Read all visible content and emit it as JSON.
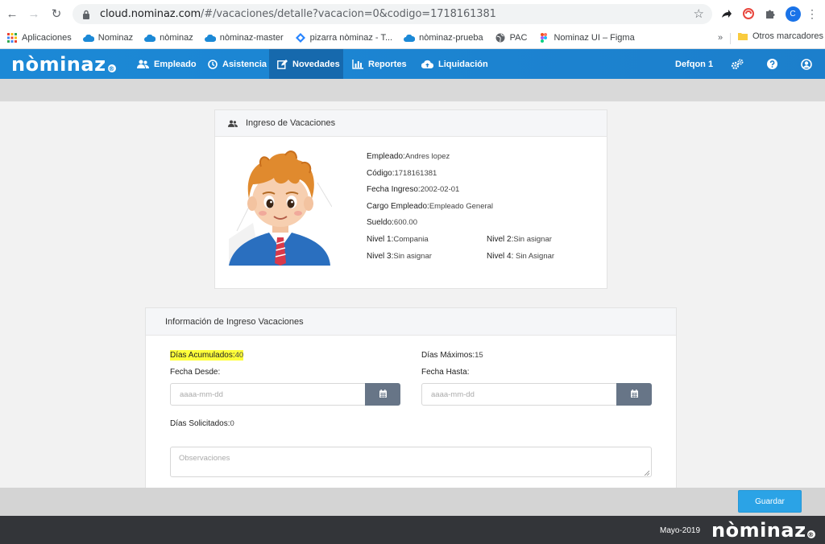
{
  "browser": {
    "url_host": "cloud.nominaz.com",
    "url_path": "/#/vacaciones/detalle?vacacion=0&codigo=1718161381",
    "profile_initial": "C",
    "bookmarks": [
      {
        "label": "Aplicaciones",
        "icon": "apps-grid-icon"
      },
      {
        "label": "Nominaz",
        "icon": "cloud-icon"
      },
      {
        "label": "nòminaz",
        "icon": "cloud-icon"
      },
      {
        "label": "nòminaz-master",
        "icon": "cloud-icon"
      },
      {
        "label": "pizarra nòminaz - T...",
        "icon": "diamond-icon"
      },
      {
        "label": "nòminaz-prueba",
        "icon": "cloud-icon"
      },
      {
        "label": "PAC",
        "icon": "globe-icon"
      },
      {
        "label": "Nominaz UI – Figma",
        "icon": "figma-icon"
      }
    ],
    "bookmarks_more": "»",
    "other_bookmarks": "Otros marcadores"
  },
  "app": {
    "logo_text": "nòminaz",
    "nav": [
      {
        "label": "Empleado",
        "icon": "users-icon",
        "active": false
      },
      {
        "label": "Asistencia",
        "icon": "clock-icon",
        "active": false
      },
      {
        "label": "Novedades",
        "icon": "edit-icon",
        "active": true
      },
      {
        "label": "Reportes",
        "icon": "bar-chart-icon",
        "active": false
      },
      {
        "label": "Liquidación",
        "icon": "cloud-upload-icon",
        "active": false
      }
    ],
    "company": "Defqon 1"
  },
  "employee_card": {
    "title": "Ingreso de Vacaciones",
    "fields": {
      "empleado_label": "Empleado:",
      "empleado": "Andres lopez",
      "codigo_label": "Código:",
      "codigo": "1718161381",
      "fecha_ingreso_label": "Fecha Ingreso:",
      "fecha_ingreso": "2002-02-01",
      "cargo_label": "Cargo Empleado:",
      "cargo": "Empleado General",
      "sueldo_label": "Sueldo:",
      "sueldo": "600.00",
      "nivel1_label": "Nivel 1:",
      "nivel1": "Compania",
      "nivel2_label": "Nivel 2:",
      "nivel2": "Sin asignar",
      "nivel3_label": "Nivel 3:",
      "nivel3": "Sin asignar",
      "nivel4_label": "Nivel 4:",
      "nivel4": " Sin Asignar"
    }
  },
  "vacation_card": {
    "title": "Información de Ingreso Vacaciones",
    "dias_acumulados_label": "Días Acumulados:",
    "dias_acumulados": "40",
    "dias_maximos_label": "Días Máximos:",
    "dias_maximos": "15",
    "fecha_desde_label": "Fecha Desde:",
    "fecha_hasta_label": "Fecha Hasta:",
    "date_placeholder": "aaaa-mm-dd",
    "dias_solicitados_label": "Días Solicitados:",
    "dias_solicitados": "0",
    "observaciones_placeholder": "Observaciones"
  },
  "actions": {
    "save_label": "Guardar"
  },
  "footer": {
    "date": "Mayo-2019",
    "logo_text": "nòminaz"
  }
}
